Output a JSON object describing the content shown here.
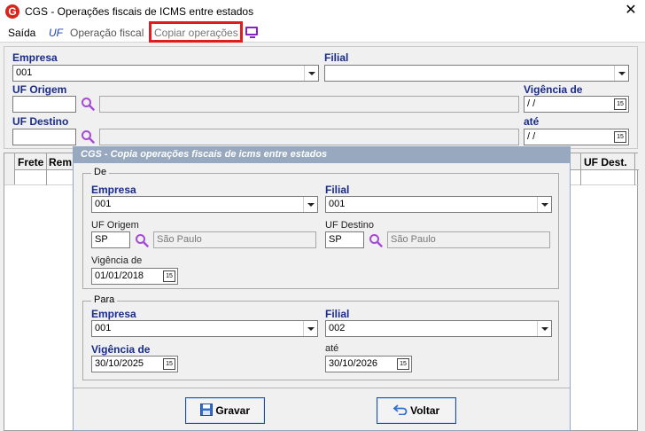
{
  "window": {
    "title": "CGS - Operações fiscais de ICMS entre estados",
    "close_glyph": "✕",
    "app_icon_letter": "G"
  },
  "menu": {
    "saida": "Saída",
    "uf": "UF",
    "operacao_fiscal": "Operação fiscal",
    "copiar_operacoes": "Copiar operações"
  },
  "form": {
    "empresa_label": "Empresa",
    "empresa_value": "001",
    "filial_label": "Filial",
    "filial_value": "",
    "uf_origem_label": "UF Origem",
    "uf_origem_value": "",
    "uf_origem_desc": "",
    "uf_destino_label": "UF Destino",
    "uf_destino_value": "",
    "uf_destino_desc": "",
    "vigencia_de_label": "Vigência de",
    "vigencia_de_value": " / /",
    "ate_label": "até",
    "ate_value": " / /"
  },
  "grid": {
    "columns": [
      "Frete",
      "Rem",
      "UF Dest."
    ]
  },
  "dialog": {
    "title": "CGS - Copia operações fiscais de icms entre estados",
    "de": {
      "legend": "De",
      "empresa_label": "Empresa",
      "empresa_value": "001",
      "filial_label": "Filial",
      "filial_value": "001",
      "uf_origem_label": "UF Origem",
      "uf_origem_value": "SP",
      "uf_origem_desc": "São Paulo",
      "uf_destino_label": "UF Destino",
      "uf_destino_value": "SP",
      "uf_destino_desc": "São Paulo",
      "vigencia_label": "Vigência de",
      "vigencia_value": "01/01/2018"
    },
    "para": {
      "legend": "Para",
      "empresa_label": "Empresa",
      "empresa_value": "001",
      "filial_label": "Filial",
      "filial_value": "002",
      "vigencia_label": "Vigência de",
      "vigencia_value": "30/10/2025",
      "ate_label": "até",
      "ate_value": "30/10/2026"
    },
    "gravar_label": "Gravar",
    "voltar_label": "Voltar"
  },
  "calendar_glyph": "15",
  "colors": {
    "accent_label": "#1a2c8a",
    "highlight": "#e01d1d",
    "dialog_title": "#98a9bf"
  }
}
